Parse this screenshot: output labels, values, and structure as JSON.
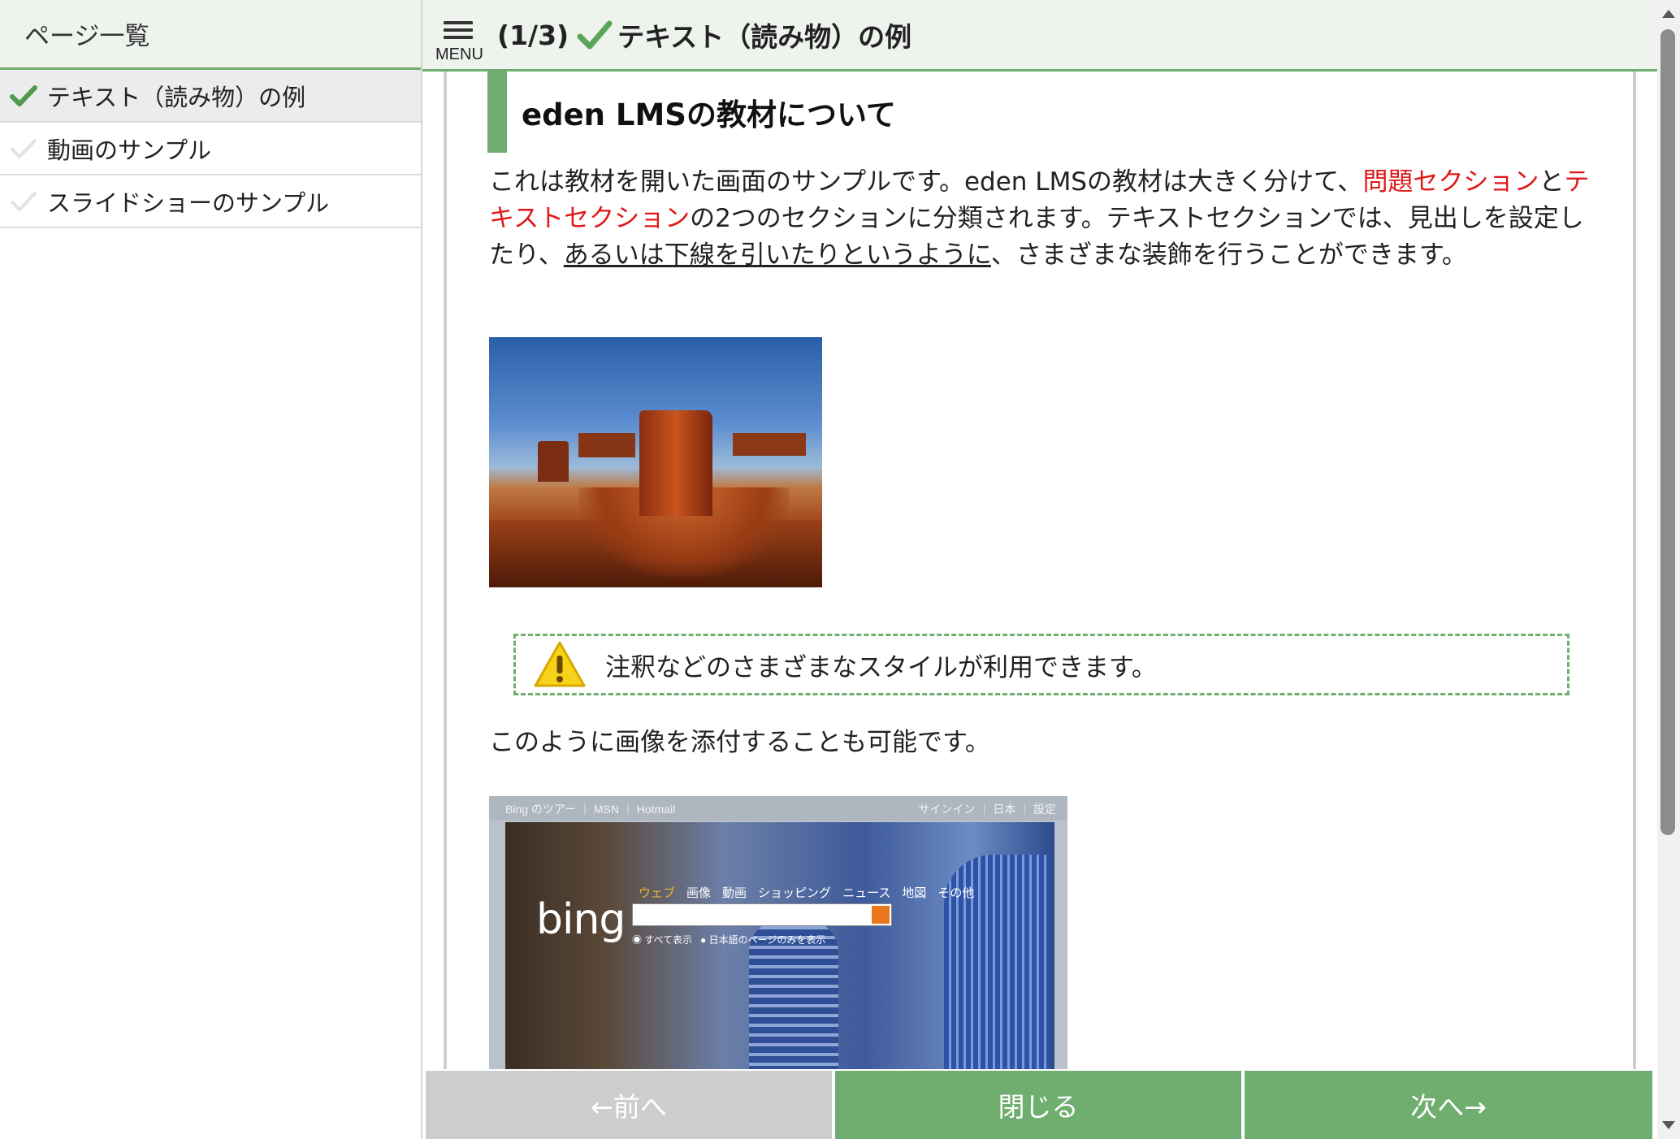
{
  "sidebar": {
    "header": "ページ一覧",
    "items": [
      {
        "label": "テキスト（読み物）の例",
        "status": "completed"
      },
      {
        "label": "動画のサンプル",
        "status": "not-completed"
      },
      {
        "label": "スライドショーのサンプル",
        "status": "not-completed"
      }
    ]
  },
  "topbar": {
    "menu_label": "MENU",
    "counter": "(1/3)",
    "title": "テキスト（読み物）の例"
  },
  "content": {
    "heading": "eden LMSの教材について",
    "intro": {
      "part1": "これは教材を開いた画面のサンプルです。eden LMSの教材は大きく分けて、",
      "red1": "問題セクション",
      "part2": "と",
      "red2": "テキストセクション",
      "part3": "の2つのセクションに分類されます。テキストセクションでは、見出しを設定したり、",
      "underlined": "あるいは下線を引いたりというように",
      "part4": "、さまざまな装飾を行うことができます。"
    },
    "note": "注釈などのさまざまなスタイルが利用できます。",
    "para2": "このように画像を添付することも可能です。",
    "bing_image": {
      "top_left": "Bing のツアー ｜ MSN ｜ Hotmail",
      "top_right": "サインイン ｜ 日本 ｜ 設定",
      "logo": "bing",
      "tabs": [
        "ウェブ",
        "画像",
        "動画",
        "ショッピング",
        "ニュース",
        "地図",
        "その他"
      ],
      "radio1": "すべて表示",
      "radio2": "日本語のページのみを表示"
    }
  },
  "nav": {
    "prev": "←前へ",
    "close": "閉じる",
    "next": "次へ→"
  },
  "colors": {
    "accent": "#6fae6f",
    "highlight_text": "#e01818",
    "disabled_button": "#cdcdcd"
  }
}
